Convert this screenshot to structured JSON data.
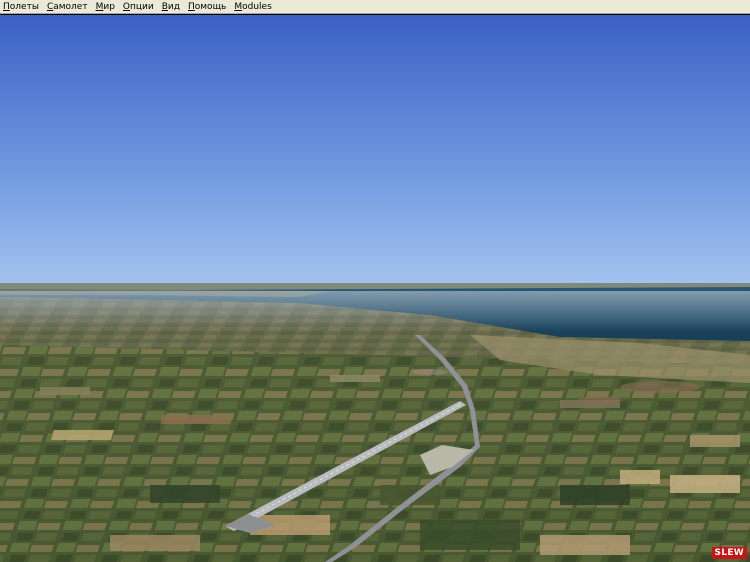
{
  "menu": [
    {
      "accel": "П",
      "rest": "олеты",
      "id": "flights"
    },
    {
      "accel": "С",
      "rest": "амолет",
      "id": "aircraft"
    },
    {
      "accel": "М",
      "rest": "ир",
      "id": "world"
    },
    {
      "accel": "О",
      "rest": "пции",
      "id": "options"
    },
    {
      "accel": "В",
      "rest": "ид",
      "id": "views"
    },
    {
      "accel": "П",
      "rest": "омощь",
      "id": "help"
    },
    {
      "accel": "M",
      "rest": "odules",
      "id": "modules"
    }
  ],
  "status": {
    "slew_label": "SLEW",
    "slew_color": "#c81414"
  },
  "scene": {
    "sky_top": "#3b63c6",
    "sky_horizon": "#8fb4ea",
    "sea": "#1d4a62",
    "land": "#4a5a35",
    "runway": "#b9bbbe",
    "road": "#8e9096"
  }
}
